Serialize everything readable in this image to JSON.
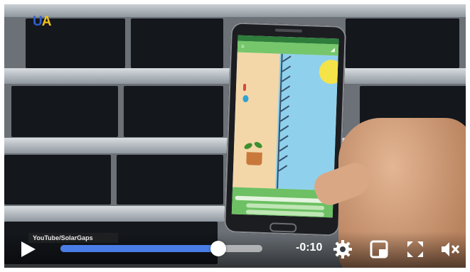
{
  "overlay": {
    "logo_part1": "U",
    "logo_part2": "A",
    "caption": "YouTube/SolarGaps"
  },
  "player": {
    "time_remaining": "-0:10",
    "progress_fraction": 0.78,
    "colors": {
      "progress": "#4a7de6",
      "logo_u": "#2f5fd0",
      "logo_a": "#f2c31b"
    }
  },
  "icons": {
    "play": "play-icon",
    "settings": "gear-icon",
    "pip": "picture-in-picture-icon",
    "fullscreen": "fullscreen-icon",
    "mute": "mute-icon"
  }
}
